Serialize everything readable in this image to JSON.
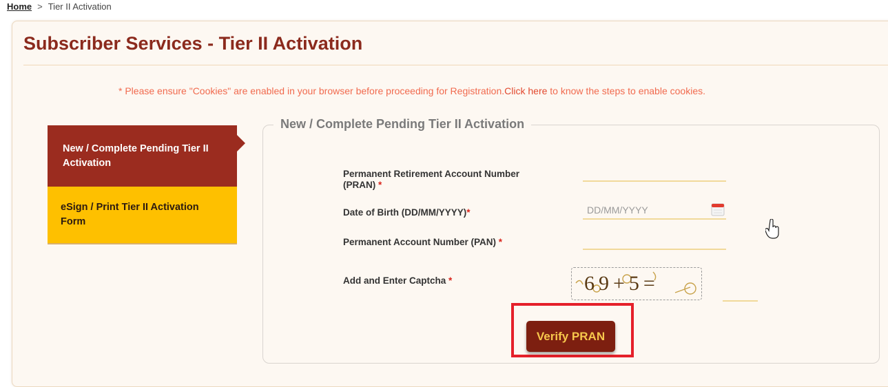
{
  "breadcrumb": {
    "home": "Home",
    "separator": ">",
    "current": "Tier II Activation"
  },
  "page_title": "Subscriber Services - Tier II Activation",
  "cookie_notice": {
    "before": "* Please ensure \"Cookies\" are enabled in your browser before proceeding for Registration.",
    "link": "Click here",
    "after": " to know the steps to enable cookies."
  },
  "tabs": [
    {
      "label": "New / Complete Pending Tier II Activation",
      "active": true
    },
    {
      "label": "eSign / Print Tier II Activation Form",
      "active": false
    }
  ],
  "form": {
    "legend": "New / Complete Pending Tier II Activation",
    "pran_label": "Permanent Retirement Account Number (PRAN)",
    "pran_value": "",
    "dob_label": "Date of Birth (DD/MM/YYYY)",
    "dob_placeholder": "DD/MM/YYYY",
    "pan_label": "Permanent Account Number (PAN)",
    "pan_value": "",
    "captcha_label": "Add and Enter Captcha",
    "captcha_text": "69+5=",
    "required_mark": "*",
    "submit_label": "Verify PRAN"
  },
  "colors": {
    "brand": "#9b2c1f",
    "accent_yellow": "#fec000",
    "notice": "#f16a4e",
    "highlight": "#e5202a"
  },
  "icons": {
    "calendar": "calendar-icon",
    "cursor": "hand-pointer-icon"
  }
}
